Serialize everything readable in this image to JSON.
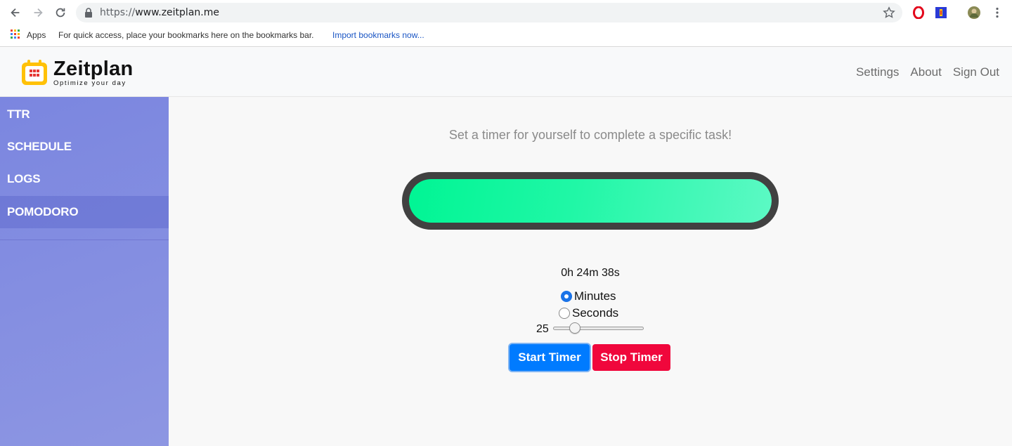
{
  "browser": {
    "url_scheme": "https://",
    "url_host": "www.zeitplan.me",
    "bookmarks": {
      "apps_label": "Apps",
      "hint": "For quick access, place your bookmarks here on the bookmarks bar.",
      "import_link": "Import bookmarks now..."
    }
  },
  "app": {
    "logo_title": "Zeitplan",
    "logo_subtitle": "Optimize your day",
    "nav": [
      "Settings",
      "About",
      "Sign Out"
    ]
  },
  "sidebar": {
    "items": [
      {
        "label": "TTR",
        "active": false
      },
      {
        "label": "SCHEDULE",
        "active": false
      },
      {
        "label": "LOGS",
        "active": false
      },
      {
        "label": "POMODORO",
        "active": true
      }
    ]
  },
  "pomodoro": {
    "tagline": "Set a timer for yourself to complete a specific task!",
    "progress_fraction": 1.0,
    "time_remaining": "0h 24m 38s",
    "unit_options": [
      {
        "label": "Minutes",
        "checked": true
      },
      {
        "label": "Seconds",
        "checked": false
      }
    ],
    "slider": {
      "value": 25,
      "min": 1,
      "max": 120
    },
    "start_label": "Start Timer",
    "stop_label": "Stop Timer"
  },
  "colors": {
    "sidebar_bg": "#7b86e0",
    "progress_fill": "#00f594",
    "progress_frame": "#414141",
    "start_button": "#007bff",
    "stop_button": "#f0073c"
  }
}
